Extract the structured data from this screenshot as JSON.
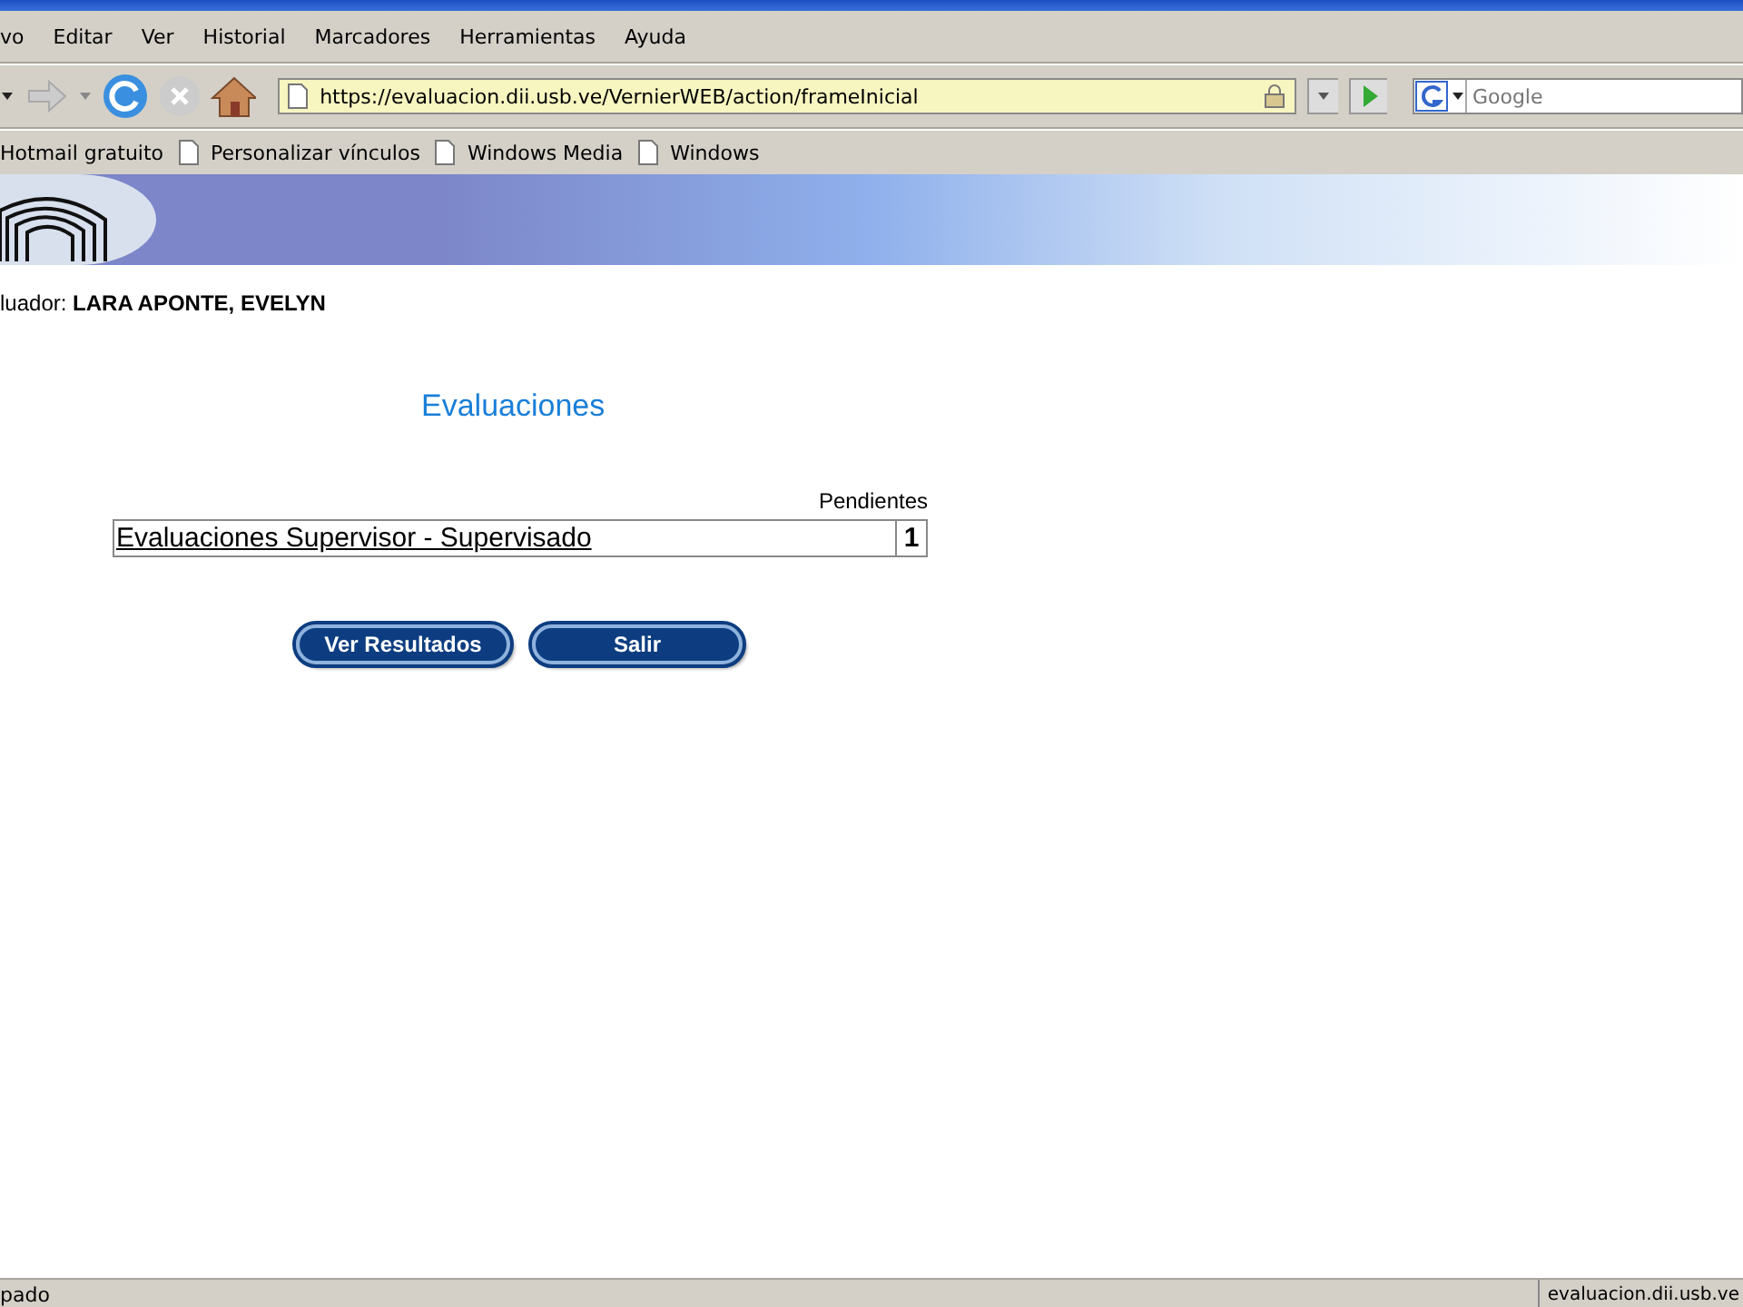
{
  "menu": [
    "vo",
    "Editar",
    "Ver",
    "Historial",
    "Marcadores",
    "Herramientas",
    "Ayuda"
  ],
  "address": {
    "value": "https://evaluacion.dii.usb.ve/VernierWEB/action/frameInicial"
  },
  "search": {
    "placeholder": "Google"
  },
  "bookmarks": [
    {
      "label": "Hotmail gratuito",
      "kind": "plain"
    },
    {
      "label": "Personalizar vínculos",
      "kind": "page"
    },
    {
      "label": "Windows Media",
      "kind": "page"
    },
    {
      "label": "Windows",
      "kind": "page"
    }
  ],
  "evaluator": {
    "label": "luador:",
    "name": "LARA APONTE, EVELYN"
  },
  "heading": "Evaluaciones",
  "table": {
    "columns": [
      "Pendientes"
    ],
    "rows": [
      {
        "name": "Evaluaciones Supervisor - Supervisado",
        "count": "1"
      }
    ]
  },
  "buttons": [
    "Ver Resultados",
    "Salir"
  ],
  "status_bar": {
    "left": "pado",
    "right": "evaluacion.dii.usb.ve"
  }
}
